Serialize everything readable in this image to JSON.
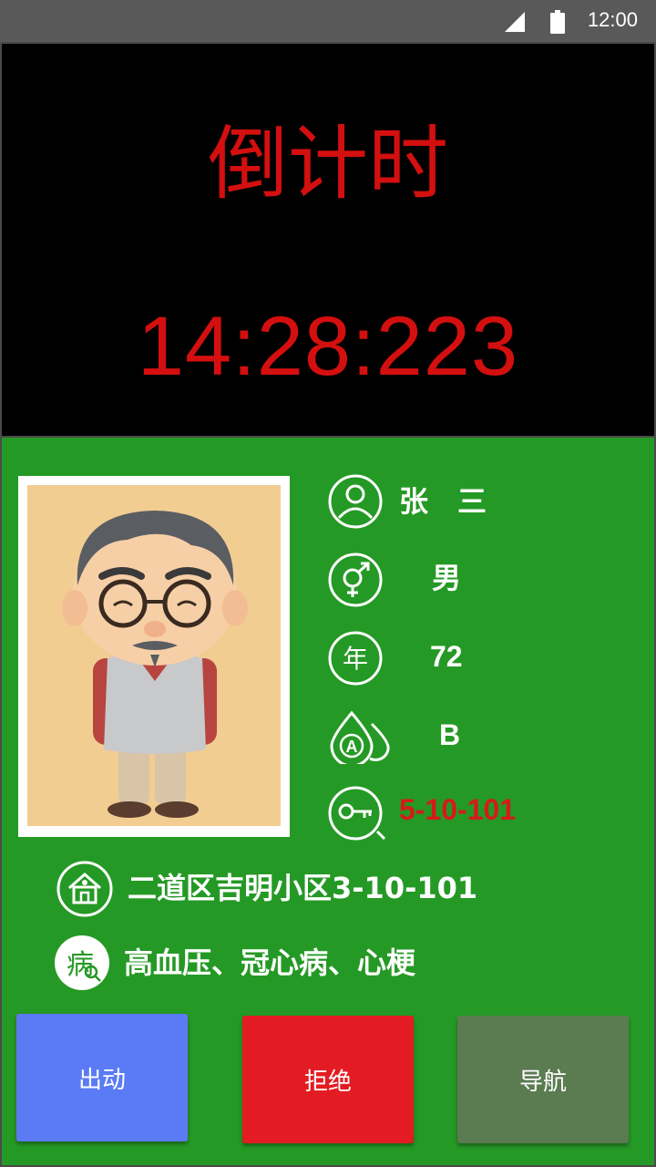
{
  "status_bar": {
    "time": "12:00",
    "signal_icon": "signal-icon",
    "battery_icon": "battery-icon"
  },
  "timer": {
    "title": "倒计时",
    "value": "14:28:223",
    "color": "#d40f0f"
  },
  "patient": {
    "photo": "elderly-man-avatar",
    "name": "张　三",
    "gender": "男",
    "age": "72",
    "blood_type": "B",
    "room_key": "5-10-101",
    "address": "二道区吉明小区3-10-101",
    "diseases": "高血压、冠心病、心梗"
  },
  "actions": {
    "dispatch": "出动",
    "reject": "拒绝",
    "navigate": "导航"
  },
  "colors": {
    "panel_green": "#259925",
    "dispatch_blue": "#5b7bf5",
    "reject_red": "#e31c23",
    "navigate_gray_green": "#5b7b51",
    "key_red": "#d61a1a"
  }
}
